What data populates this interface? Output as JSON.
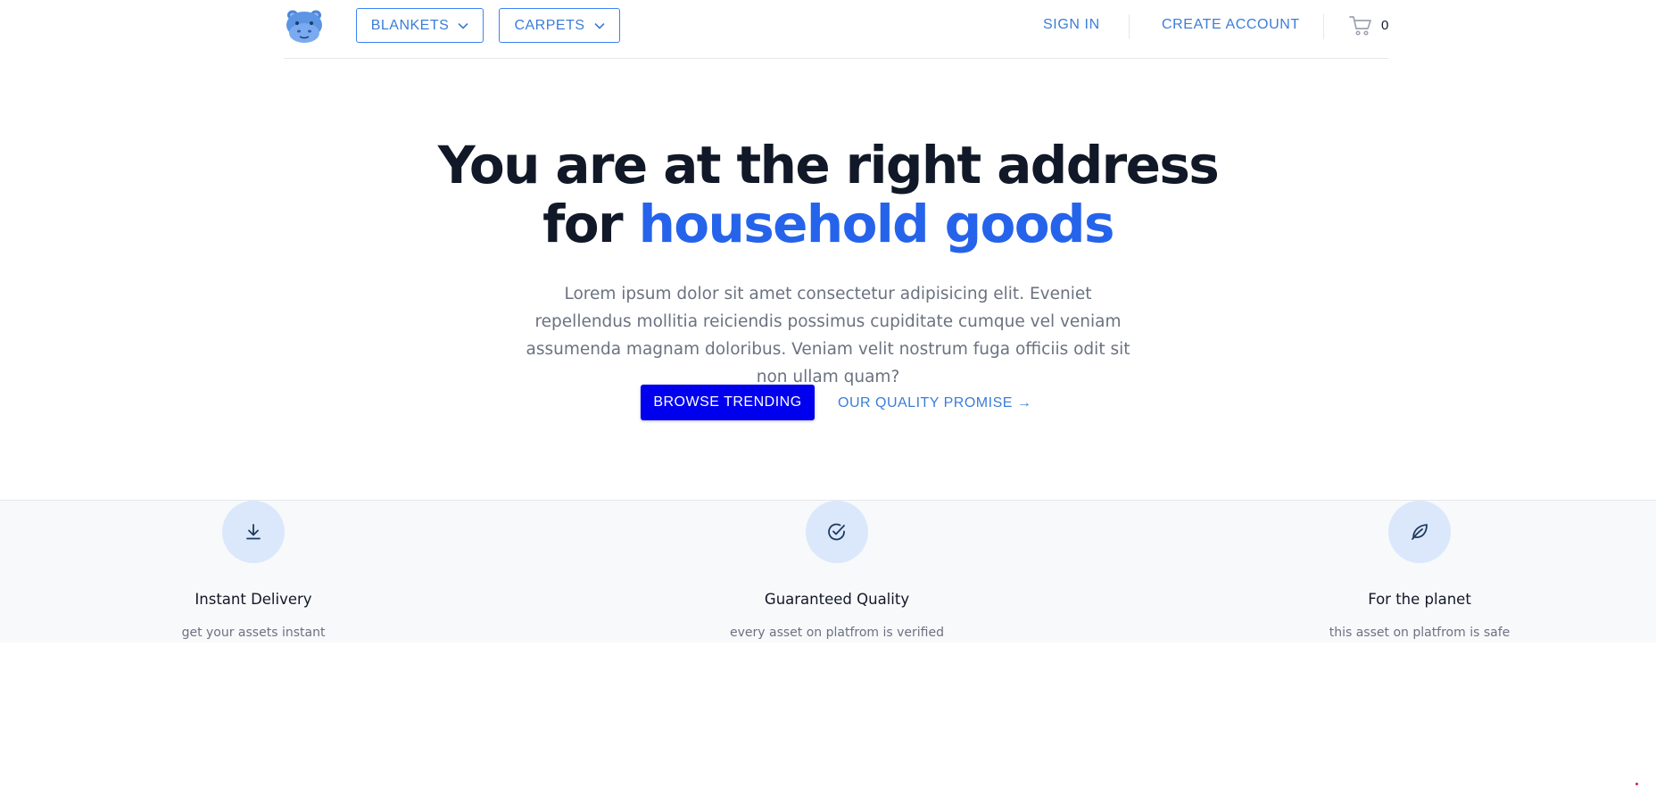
{
  "header": {
    "nav": {
      "blankets_label": "BLANKETS",
      "carpets_label": "CARPETS",
      "sign_in_label": "SIGN IN",
      "create_account_label": "CREATE ACCOUNT"
    },
    "cart": {
      "count": "0"
    }
  },
  "hero": {
    "title_line1": "You are at the right address",
    "title_line2_prefix": "for ",
    "title_line2_accent": "household goods",
    "description": "Lorem ipsum dolor sit amet consectetur adipisicing elit. Eveniet repellendus mollitia reiciendis possimus cupiditate cumque vel veniam assumenda magnam doloribus. Veniam velit nostrum fuga officiis odit sit non ullam quam?",
    "primary_cta_label": "BROWSE TRENDING",
    "secondary_cta_label": "OUR QUALITY PROMISE →"
  },
  "features": [
    {
      "icon": "download-icon",
      "title": "Instant Delivery",
      "subtitle": "get your assets instant"
    },
    {
      "icon": "check-circle-icon",
      "title": "Guaranteed Quality",
      "subtitle": "every asset on platfrom is verified"
    },
    {
      "icon": "leaf-icon",
      "title": "For the planet",
      "subtitle": "this asset on platfrom is safe"
    }
  ],
  "colors": {
    "accent": "#2563eb",
    "link": "#3b7dd8",
    "primary_button": "#0000ee",
    "heading": "#111827",
    "muted": "#6b7280",
    "feature_icon_bg": "#dbe8fb",
    "features_bg": "#f8f9fb"
  }
}
